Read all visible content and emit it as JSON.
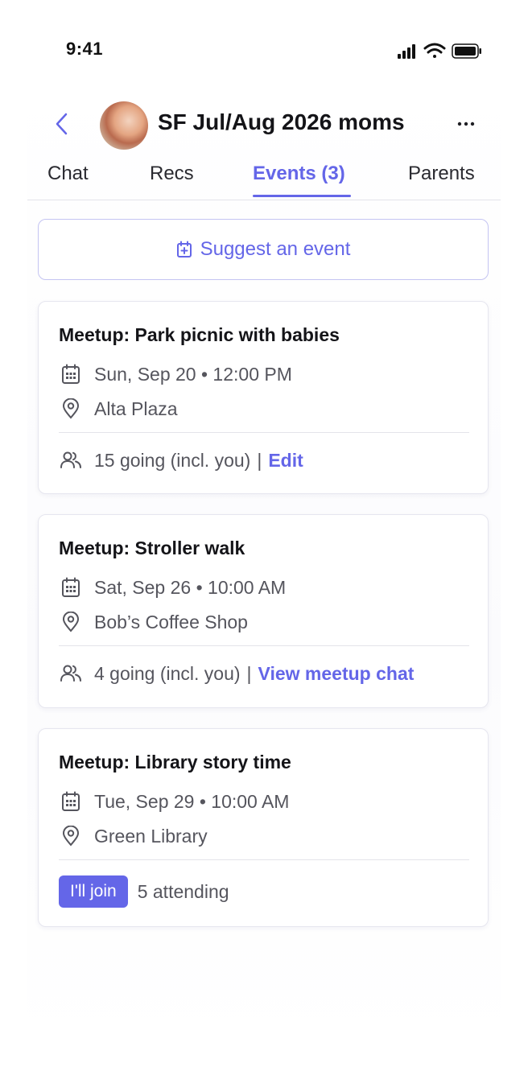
{
  "status_bar": {
    "time": "9:41"
  },
  "header": {
    "title": "SF Jul/Aug 2026 moms"
  },
  "tabs": [
    {
      "label": "Chat"
    },
    {
      "label": "Recs"
    },
    {
      "label": "Events (3)"
    },
    {
      "label": "Parents"
    }
  ],
  "suggest": {
    "label": "Suggest an event"
  },
  "events": [
    {
      "title": "Meetup: Park picnic with babies",
      "datetime": "Sun, Sep 20 • 12:00 PM",
      "location": "Alta Plaza",
      "attendance": "15 going (incl. you)",
      "separator": "|",
      "action": "Edit"
    },
    {
      "title": "Meetup: Stroller walk",
      "datetime": "Sat, Sep 26 • 10:00 AM",
      "location": "Bob’s Coffee Shop",
      "attendance": "4 going (incl. you)",
      "separator": "|",
      "action": "View meetup chat"
    },
    {
      "title": "Meetup: Library story time",
      "datetime": "Tue, Sep 29 • 10:00 AM",
      "location": "Green Library",
      "join_label": "I'll join",
      "attendance": "5 attending"
    }
  ],
  "colors": {
    "accent": "#6466e8",
    "text": "#141418",
    "muted": "#55555d",
    "border": "#e6e6ef"
  }
}
